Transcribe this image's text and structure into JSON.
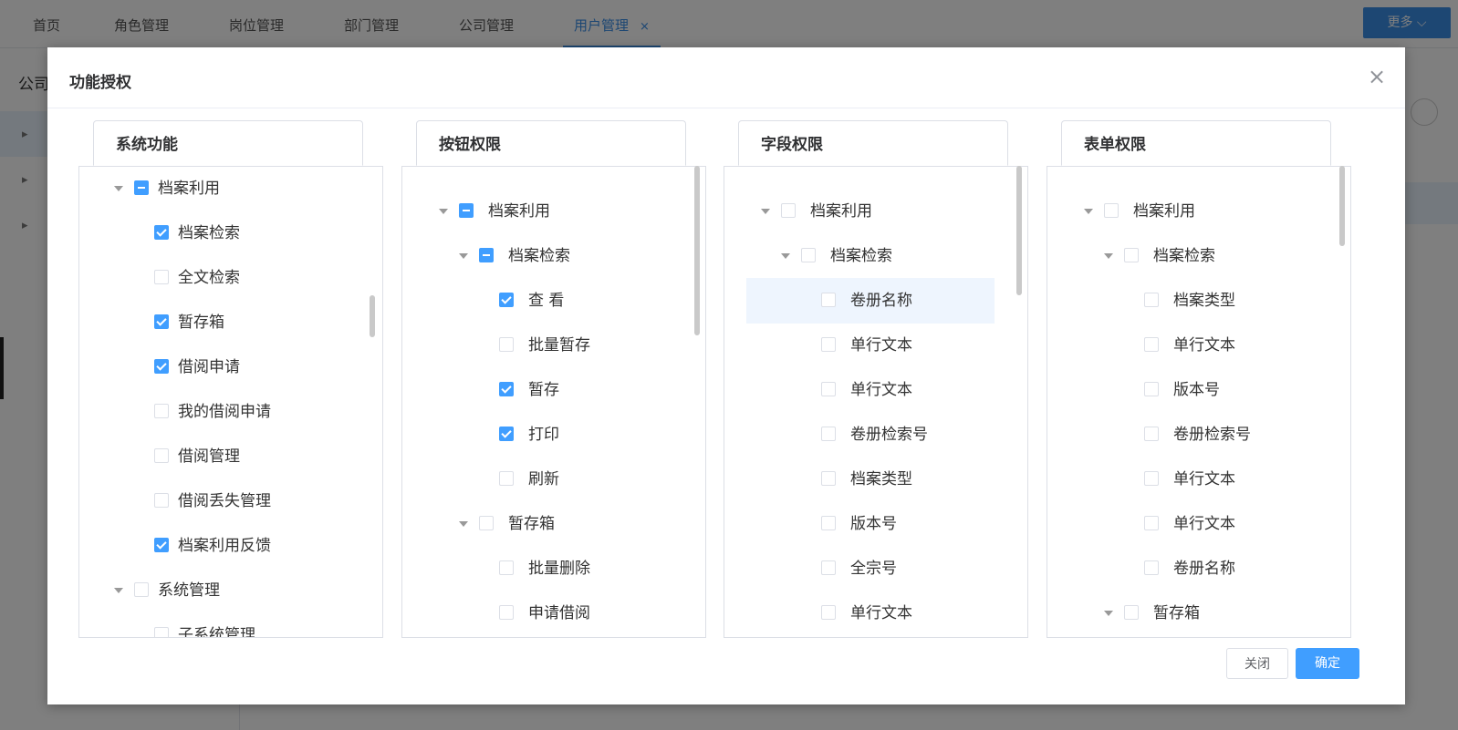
{
  "tabs": [
    {
      "label": "首页"
    },
    {
      "label": "角色管理"
    },
    {
      "label": "岗位管理"
    },
    {
      "label": "部门管理"
    },
    {
      "label": "公司管理"
    },
    {
      "label": "用户管理",
      "active": true,
      "close": "×"
    }
  ],
  "more_button": "更多 ⌵",
  "left_panel_title": "公司",
  "dialog": {
    "title": "功能授权",
    "close": "×",
    "buttons": {
      "close": "关闭",
      "confirm": "确定"
    }
  },
  "panels": [
    {
      "tab": "系统功能",
      "nodes": [
        {
          "label": "档案利用",
          "state": "indeterminate",
          "expanded": true,
          "level": 0
        },
        {
          "label": "档案检索",
          "state": "checked",
          "level": 1
        },
        {
          "label": "全文检索",
          "state": "unchecked",
          "level": 1
        },
        {
          "label": "暂存箱",
          "state": "checked",
          "level": 1
        },
        {
          "label": "借阅申请",
          "state": "checked",
          "level": 1
        },
        {
          "label": "我的借阅申请",
          "state": "unchecked",
          "level": 1
        },
        {
          "label": "借阅管理",
          "state": "unchecked",
          "level": 1
        },
        {
          "label": "借阅丢失管理",
          "state": "unchecked",
          "level": 1
        },
        {
          "label": "档案利用反馈",
          "state": "checked",
          "level": 1
        },
        {
          "label": "系统管理",
          "state": "unchecked",
          "expanded": true,
          "level": 0
        },
        {
          "label": "子系统管理",
          "state": "unchecked",
          "level": 1
        }
      ]
    },
    {
      "tab": "按钮权限",
      "nodes": [
        {
          "label": "档案利用",
          "state": "indeterminate",
          "expanded": true,
          "level": 0
        },
        {
          "label": "档案检索",
          "state": "indeterminate",
          "expanded": true,
          "level": 1
        },
        {
          "label": "查 看",
          "state": "checked",
          "level": 2
        },
        {
          "label": "批量暂存",
          "state": "unchecked",
          "level": 2
        },
        {
          "label": "暂存",
          "state": "checked",
          "level": 2
        },
        {
          "label": "打印",
          "state": "checked",
          "level": 2
        },
        {
          "label": "刷新",
          "state": "unchecked",
          "level": 2
        },
        {
          "label": "暂存箱",
          "state": "unchecked",
          "expanded": true,
          "level": 1
        },
        {
          "label": "批量删除",
          "state": "unchecked",
          "level": 2
        },
        {
          "label": "申请借阅",
          "state": "unchecked",
          "level": 2
        }
      ]
    },
    {
      "tab": "字段权限",
      "nodes": [
        {
          "label": "档案利用",
          "state": "unchecked",
          "expanded": true,
          "level": 0
        },
        {
          "label": "档案检索",
          "state": "unchecked",
          "expanded": true,
          "level": 1
        },
        {
          "label": "卷册名称",
          "state": "unchecked",
          "level": 2,
          "highlight": true
        },
        {
          "label": "单行文本",
          "state": "unchecked",
          "level": 2
        },
        {
          "label": "单行文本",
          "state": "unchecked",
          "level": 2
        },
        {
          "label": "卷册检索号",
          "state": "unchecked",
          "level": 2
        },
        {
          "label": "档案类型",
          "state": "unchecked",
          "level": 2
        },
        {
          "label": "版本号",
          "state": "unchecked",
          "level": 2
        },
        {
          "label": "全宗号",
          "state": "unchecked",
          "level": 2
        },
        {
          "label": "单行文本",
          "state": "unchecked",
          "level": 2
        }
      ]
    },
    {
      "tab": "表单权限",
      "nodes": [
        {
          "label": "档案利用",
          "state": "unchecked",
          "expanded": true,
          "level": 0
        },
        {
          "label": "档案检索",
          "state": "unchecked",
          "expanded": true,
          "level": 1
        },
        {
          "label": "档案类型",
          "state": "unchecked",
          "level": 2
        },
        {
          "label": "单行文本",
          "state": "unchecked",
          "level": 2
        },
        {
          "label": "版本号",
          "state": "unchecked",
          "level": 2
        },
        {
          "label": "卷册检索号",
          "state": "unchecked",
          "level": 2
        },
        {
          "label": "单行文本",
          "state": "unchecked",
          "level": 2
        },
        {
          "label": "单行文本",
          "state": "unchecked",
          "level": 2
        },
        {
          "label": "卷册名称",
          "state": "unchecked",
          "level": 2
        },
        {
          "label": "暂存箱",
          "state": "unchecked",
          "expanded": true,
          "level": 1
        }
      ]
    }
  ]
}
